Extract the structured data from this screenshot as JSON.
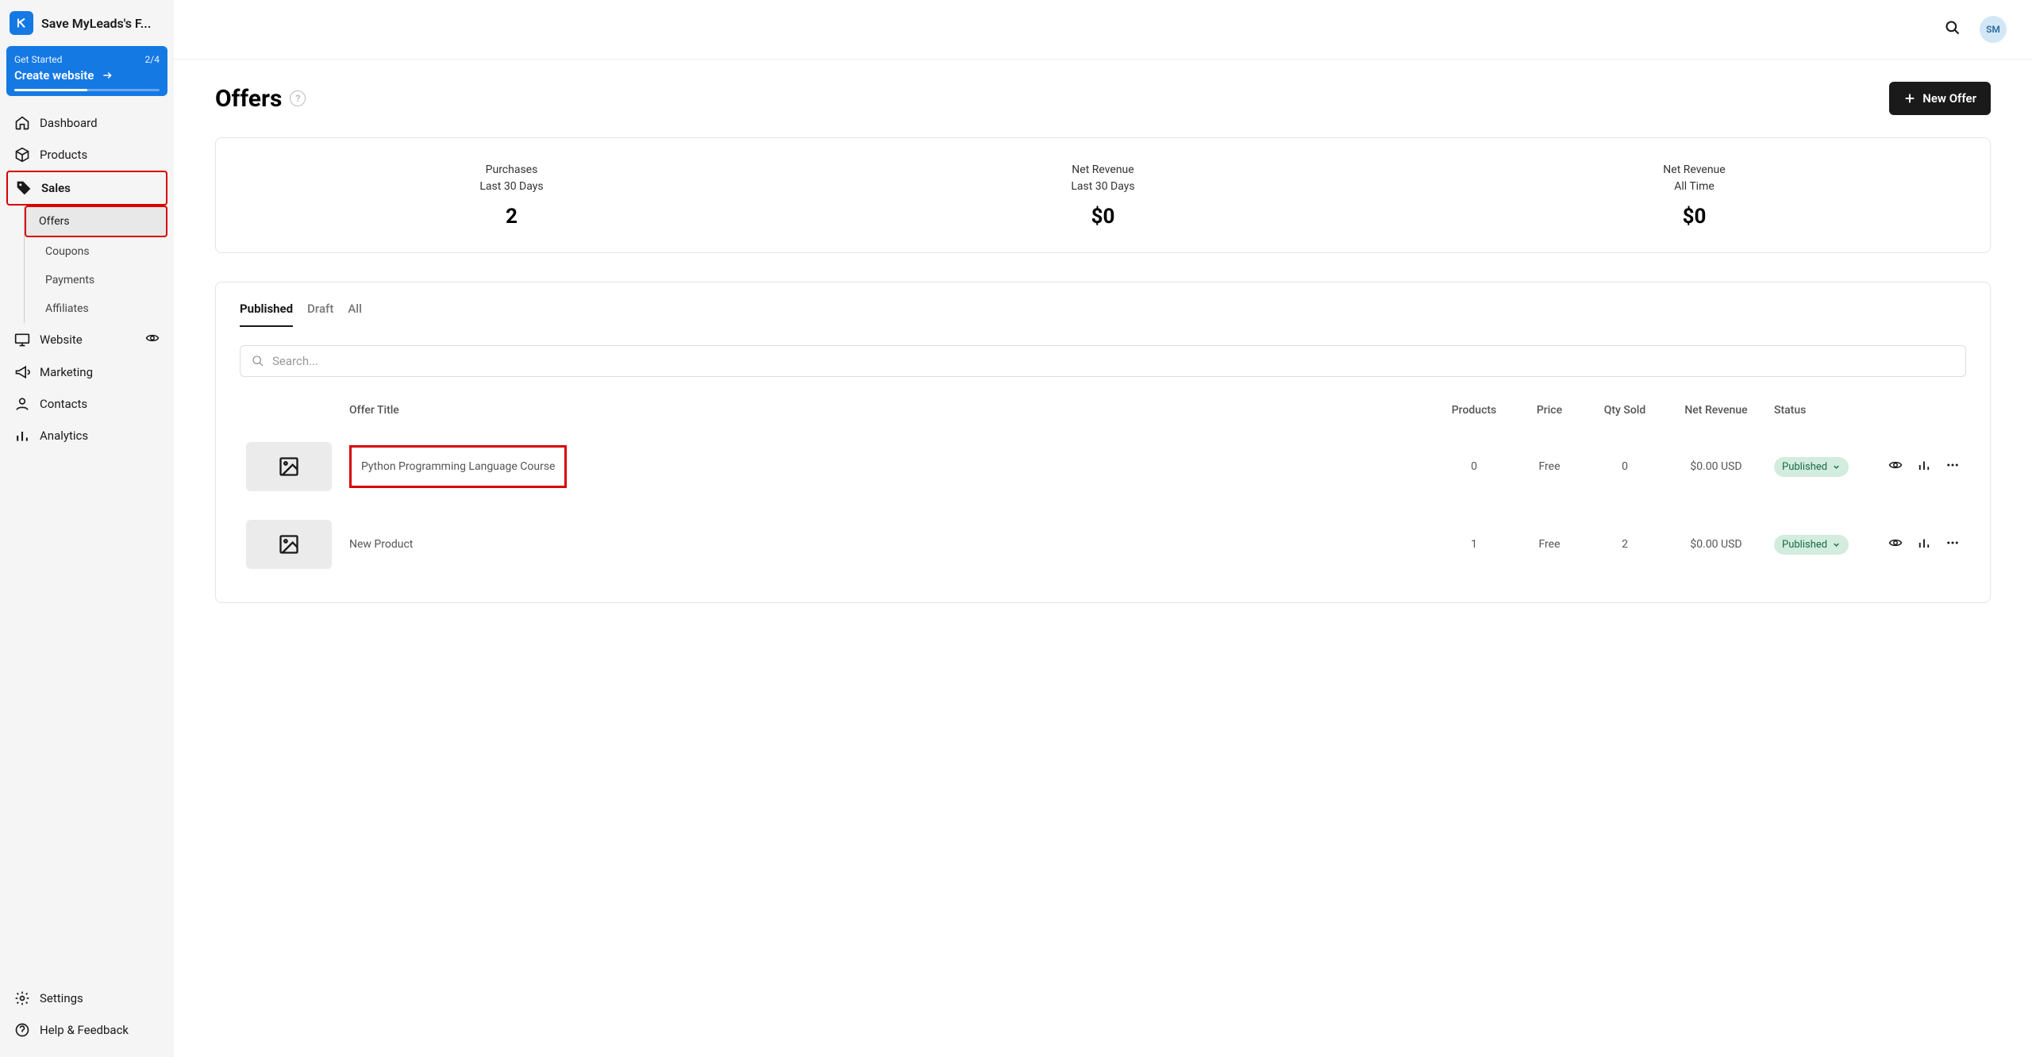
{
  "site": {
    "title": "Save MyLeads's F..."
  },
  "get_started": {
    "label": "Get Started",
    "progress": "2/4",
    "cta": "Create website"
  },
  "nav": {
    "dashboard": "Dashboard",
    "products": "Products",
    "sales": "Sales",
    "sales_sub": {
      "offers": "Offers",
      "coupons": "Coupons",
      "payments": "Payments",
      "affiliates": "Affiliates"
    },
    "website": "Website",
    "marketing": "Marketing",
    "contacts": "Contacts",
    "analytics": "Analytics",
    "settings": "Settings",
    "help": "Help & Feedback"
  },
  "avatar": "SM",
  "page": {
    "title": "Offers",
    "new_offer": "New Offer"
  },
  "stats": {
    "purchases_label1": "Purchases",
    "purchases_label2": "Last 30 Days",
    "purchases_value": "2",
    "netrev30_label1": "Net Revenue",
    "netrev30_label2": "Last 30 Days",
    "netrev30_value": "$0",
    "netrevall_label1": "Net Revenue",
    "netrevall_label2": "All Time",
    "netrevall_value": "$0"
  },
  "tabs": {
    "published": "Published",
    "draft": "Draft",
    "all": "All"
  },
  "search": {
    "placeholder": "Search..."
  },
  "table": {
    "headers": {
      "title": "Offer Title",
      "products": "Products",
      "price": "Price",
      "qty": "Qty Sold",
      "net": "Net Revenue",
      "status": "Status"
    },
    "rows": [
      {
        "title": "Python Programming Language Course",
        "products": "0",
        "price": "Free",
        "qty": "0",
        "net": "$0.00 USD",
        "status": "Published",
        "highlight": true
      },
      {
        "title": "New Product",
        "products": "1",
        "price": "Free",
        "qty": "2",
        "net": "$0.00 USD",
        "status": "Published",
        "highlight": false
      }
    ]
  }
}
